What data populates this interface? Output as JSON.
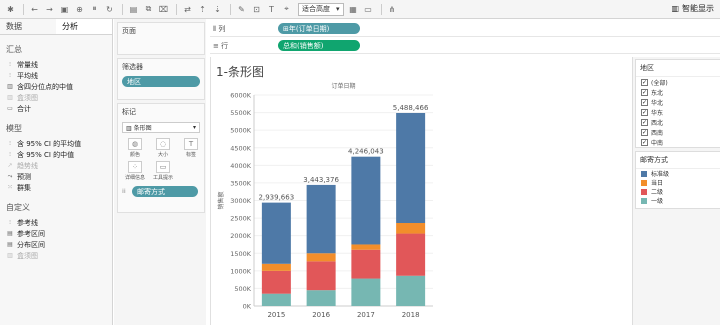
{
  "toolbar": {
    "fit_label": "适合高度",
    "smart_show_label": "智能显示"
  },
  "left_pane": {
    "tabs": [
      "数据",
      "分析"
    ],
    "sections": [
      {
        "title": "汇总",
        "items": [
          {
            "label": "常量线",
            "icon": "line-icon",
            "enabled": true
          },
          {
            "label": "平均线",
            "icon": "line-icon",
            "enabled": true
          },
          {
            "label": "含四分位点的中值",
            "icon": "box-icon",
            "enabled": true
          },
          {
            "label": "盒须图",
            "icon": "box-icon",
            "enabled": false
          },
          {
            "label": "合计",
            "icon": "total-icon",
            "enabled": true
          }
        ]
      },
      {
        "title": "模型",
        "items": [
          {
            "label": "含 95% CI 的平均值",
            "icon": "line-icon",
            "enabled": true
          },
          {
            "label": "含 95% CI 的中值",
            "icon": "line-icon",
            "enabled": true
          },
          {
            "label": "趋势线",
            "icon": "trend-icon",
            "enabled": false
          },
          {
            "label": "预测",
            "icon": "forecast-icon",
            "enabled": true
          },
          {
            "label": "群集",
            "icon": "cluster-icon",
            "enabled": true
          }
        ]
      },
      {
        "title": "自定义",
        "items": [
          {
            "label": "参考线",
            "icon": "line-icon",
            "enabled": true
          },
          {
            "label": "参考区间",
            "icon": "band-icon",
            "enabled": true
          },
          {
            "label": "分布区间",
            "icon": "band-icon",
            "enabled": true
          },
          {
            "label": "盒须图",
            "icon": "box-icon",
            "enabled": false
          }
        ]
      }
    ]
  },
  "cards": {
    "pages_title": "页面",
    "filters_title": "筛选器",
    "filter_pill": "地区",
    "marks_title": "标记",
    "marks_type": "条形图",
    "marks_buttons": [
      "颜色",
      "大小",
      "标签",
      "详细信息",
      "工具提示"
    ],
    "marks_pill": "邮寄方式"
  },
  "shelves": {
    "columns_label": "列",
    "columns_pill": "年(订单日期)",
    "rows_label": "行",
    "rows_pill": "总和(销售额)"
  },
  "viz": {
    "sheet_title": "1-条形图"
  },
  "legends": {
    "region_title": "地区",
    "regions": [
      "(全部)",
      "东北",
      "华北",
      "华东",
      "西北",
      "西南",
      "中南"
    ],
    "ship_title": "邮寄方式",
    "ship_modes": [
      {
        "label": "标准级",
        "color": "#4e79a7"
      },
      {
        "label": "当日",
        "color": "#f28e2b"
      },
      {
        "label": "二级",
        "color": "#e15759"
      },
      {
        "label": "一级",
        "color": "#76b7b2"
      }
    ]
  },
  "chart_data": {
    "type": "bar",
    "stacked": true,
    "column_header": "订单日期",
    "ylabel": "销售额",
    "categories": [
      "2015",
      "2016",
      "2017",
      "2018"
    ],
    "totals": [
      "2,939,663",
      "3,443,376",
      "4,246,043",
      "5,488,466"
    ],
    "ylim": [
      0,
      6000000
    ],
    "yticks": [
      "0K",
      "500K",
      "1000K",
      "1500K",
      "2000K",
      "2500K",
      "3000K",
      "3500K",
      "4000K",
      "4500K",
      "5000K",
      "5500K",
      "6000K"
    ],
    "series": [
      {
        "name": "一级",
        "color": "#76b7b2",
        "values": [
          350000,
          450000,
          780000,
          860000
        ]
      },
      {
        "name": "二级",
        "color": "#e15759",
        "values": [
          650000,
          820000,
          820000,
          1200000
        ]
      },
      {
        "name": "当日",
        "color": "#f28e2b",
        "values": [
          200000,
          230000,
          150000,
          300000
        ]
      },
      {
        "name": "标准级",
        "color": "#4e79a7",
        "values": [
          1739663,
          1943376,
          2496043,
          3128466
        ]
      }
    ]
  }
}
